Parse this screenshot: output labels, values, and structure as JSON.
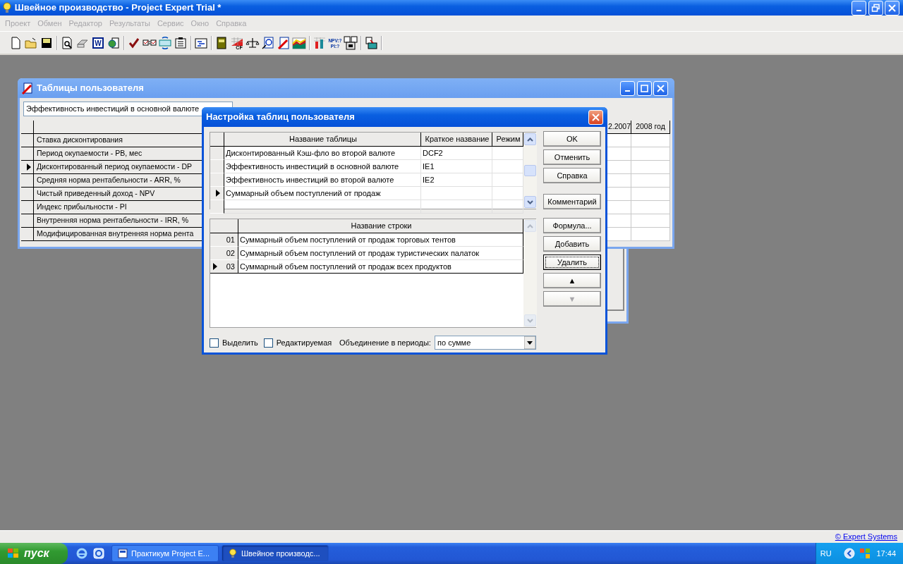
{
  "window": {
    "title": "Швейное производство - Project Expert Trial *"
  },
  "menu": [
    {
      "label": "Проект",
      "disabled": true
    },
    {
      "label": "Обмен",
      "disabled": true
    },
    {
      "label": "Редактор",
      "disabled": true
    },
    {
      "label": "Результаты",
      "disabled": true
    },
    {
      "label": "Сервис",
      "disabled": true
    },
    {
      "label": "Окно",
      "disabled": true
    },
    {
      "label": "Справка",
      "disabled": true
    }
  ],
  "toolbar": [
    [
      {
        "kind": "new"
      },
      {
        "kind": "open"
      },
      {
        "kind": "save"
      }
    ],
    [
      {
        "kind": "preview"
      },
      {
        "kind": "print"
      },
      {
        "kind": "word",
        "label": "W"
      },
      {
        "kind": "globe"
      }
    ],
    [
      {
        "kind": "check"
      },
      {
        "kind": "checklist"
      },
      {
        "kind": "sync"
      },
      {
        "kind": "clipboard"
      }
    ],
    [
      {
        "kind": "form"
      }
    ],
    [
      {
        "kind": "book"
      },
      {
        "kind": "cf",
        "label": "CF"
      },
      {
        "kind": "scales"
      },
      {
        "kind": "report"
      },
      {
        "kind": "pencil"
      },
      {
        "kind": "chart"
      }
    ],
    [
      {
        "kind": "bars"
      },
      {
        "kind": "npv",
        "lines": [
          "NPV:?",
          "PI:?"
        ]
      },
      {
        "kind": "compare"
      }
    ],
    [
      {
        "kind": "export"
      }
    ]
  ],
  "user_tables_window": {
    "title": "Таблицы пользователя",
    "table_select": "Эффективность инвестиций в основной валюте",
    "columns": [
      "2.2007",
      "2008 год"
    ],
    "rows": [
      {
        "label": "Ставка дисконтирования",
        "selected": false
      },
      {
        "label": "Период окупаемости - PB, мес",
        "selected": false
      },
      {
        "label": "Дисконтированный период окупаемости - DP",
        "selected": true
      },
      {
        "label": "Средняя норма рентабельности - ARR, %",
        "selected": false
      },
      {
        "label": "Чистый приведенный доход - NPV",
        "selected": false
      },
      {
        "label": "Индекс прибыльности - PI",
        "selected": false
      },
      {
        "label": "Внутренняя норма рентабельности - IRR, %",
        "selected": false
      },
      {
        "label": "Модифицированная внутренняя норма рента",
        "selected": false
      }
    ]
  },
  "settings_dialog": {
    "title": "Настройка таблиц пользователя",
    "tables": {
      "columns": [
        "Название таблицы",
        "Краткое название",
        "Режим"
      ],
      "rows": [
        {
          "name": "Дисконтированный Кэш-фло во второй валюте",
          "short": "DCF2",
          "selected": false
        },
        {
          "name": "Эффективность инвестиций в основной валюте",
          "short": "IE1",
          "selected": false
        },
        {
          "name": "Эффективность инвестиций во второй валюте",
          "short": "IE2",
          "selected": false
        },
        {
          "name": "Суммарный объем поступлений от продаж",
          "selected": true
        }
      ]
    },
    "table_rows": {
      "column": "Название строки",
      "rows": [
        {
          "number": "01",
          "name": "Суммарный объем поступлений от продаж торговых тентов",
          "selected": false
        },
        {
          "number": "02",
          "name": "Суммарный объем поступлений от продаж туристических палаток",
          "selected": false
        },
        {
          "number": "03",
          "name": "Суммарный объем поступлений от продаж всех продуктов",
          "selected": true
        }
      ]
    },
    "buttons": [
      [
        {
          "label": "OK",
          "disabled": false,
          "focused": false
        },
        {
          "label": "Отменить",
          "disabled": false,
          "focused": false
        },
        {
          "label": "Справка",
          "disabled": false,
          "focused": false
        }
      ],
      [
        {
          "label": "Комментарий",
          "disabled": false,
          "focused": false
        }
      ],
      [
        {
          "label": "Формула...",
          "disabled": false,
          "focused": false
        },
        {
          "label": "Добавить",
          "disabled": false,
          "focused": false
        },
        {
          "label": "Удалить",
          "disabled": false,
          "focused": true
        },
        {
          "label": "▲",
          "disabled": false,
          "focused": false
        },
        {
          "label": "▼",
          "disabled": true,
          "focused": false
        }
      ]
    ],
    "options": [
      {
        "label": "Выделить",
        "checked": false
      },
      {
        "label": "Редактируемая",
        "checked": false
      }
    ],
    "merge": {
      "label": "Объединение в периоды:",
      "value": "по сумме"
    }
  },
  "status_bar": {
    "link": "© Expert Systems"
  },
  "taskbar": {
    "start": "пуск",
    "tasks": [
      {
        "label": "Практикум Project E...",
        "selected": false
      },
      {
        "label": "Швейное производс...",
        "selected": true
      }
    ],
    "language": "RU",
    "clock": "17:44"
  }
}
